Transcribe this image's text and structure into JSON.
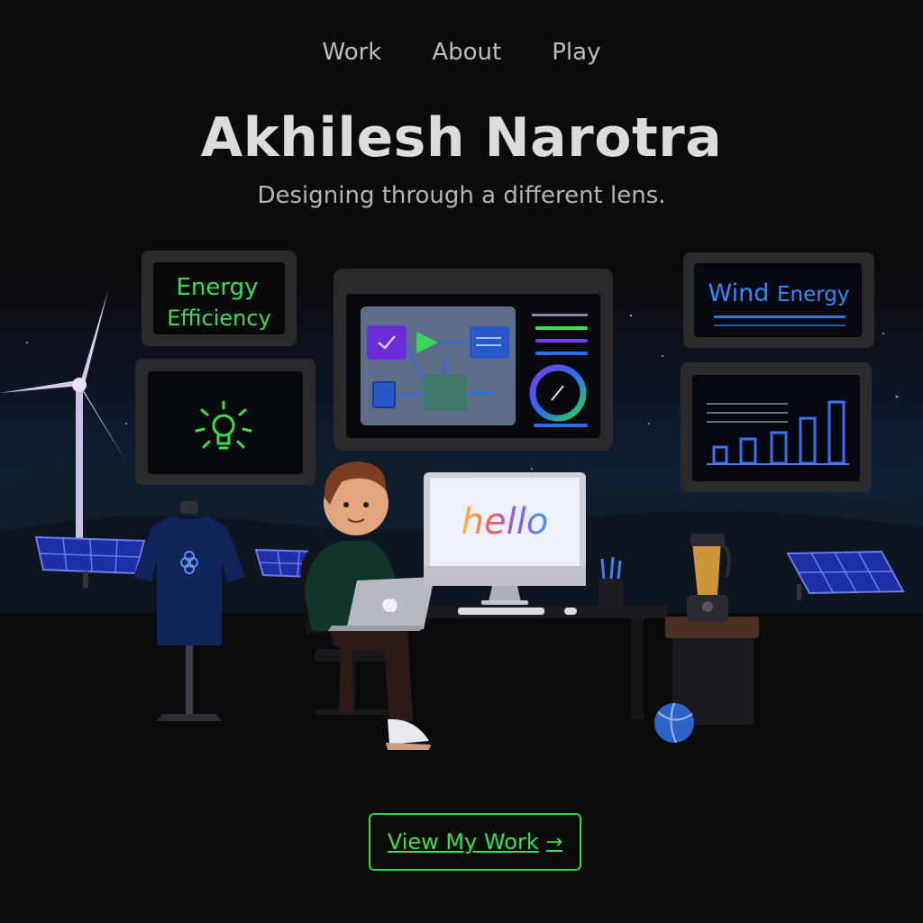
{
  "nav": {
    "items": [
      {
        "label": "Work"
      },
      {
        "label": "About"
      },
      {
        "label": "Play"
      }
    ]
  },
  "hero": {
    "title": "Akhilesh Narotra",
    "subtitle": "Designing through a different lens."
  },
  "screens": {
    "energy_line1": "Energy",
    "energy_line2": "Efficiency",
    "wind_part1": "Wind",
    "wind_part2": "Energy",
    "monitor_text": "hello"
  },
  "cta": {
    "label": "View My Work",
    "arrow": "→"
  },
  "colors": {
    "accent_green": "#2bd94b",
    "wind_blue": "#2b8cff",
    "background": "#0b0b0c"
  },
  "icons": [
    "lightbulb-icon",
    "arrow-right-icon",
    "apple-logo-icon",
    "flower-logo-icon"
  ]
}
